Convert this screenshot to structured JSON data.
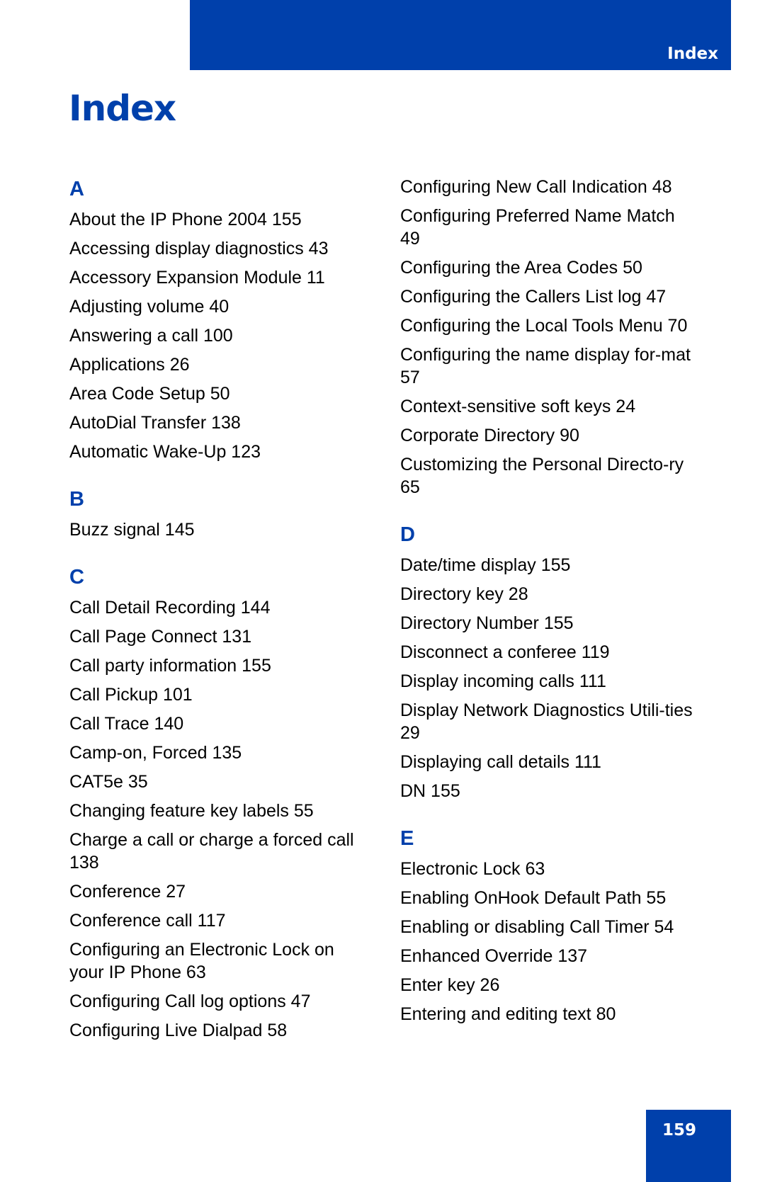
{
  "header": {
    "running_title": "Index",
    "accent_color": "#0040ab"
  },
  "page": {
    "title": "Index",
    "page_number": "159"
  },
  "columns": [
    {
      "sections": [
        {
          "letter": "A",
          "entries": [
            "About the IP Phone 2004 155",
            "Accessing display diagnostics 43",
            "Accessory Expansion Module 11",
            "Adjusting volume 40",
            "Answering a call 100",
            "Applications 26",
            "Area Code Setup 50",
            "AutoDial Transfer 138",
            "Automatic Wake-Up 123"
          ]
        },
        {
          "letter": "B",
          "entries": [
            "Buzz signal 145"
          ]
        },
        {
          "letter": "C",
          "entries": [
            "Call Detail Recording 144",
            "Call Page Connect 131",
            "Call party information 155",
            "Call Pickup 101",
            "Call Trace 140",
            "Camp-on, Forced 135",
            "CAT5e 35",
            "Changing feature key labels 55",
            "Charge a call or charge a forced call 138",
            "Conference 27",
            "Conference call 117",
            "Configuring an Electronic Lock on your IP Phone 63",
            "Configuring Call log options 47",
            "Configuring Live Dialpad 58"
          ]
        }
      ]
    },
    {
      "sections": [
        {
          "letter": "",
          "entries": [
            "Configuring New Call Indication 48",
            "Configuring Preferred Name Match 49",
            "Configuring the Area Codes 50",
            "Configuring the Callers List log 47",
            "Configuring the Local Tools Menu 70",
            "Configuring the name display for-mat 57",
            "Context-sensitive soft keys 24",
            "Corporate Directory 90",
            "Customizing the Personal Directo-ry 65"
          ]
        },
        {
          "letter": "D",
          "entries": [
            "Date/time display 155",
            "Directory key 28",
            "Directory Number 155",
            "Disconnect a conferee 119",
            "Display incoming calls 111",
            "Display Network Diagnostics Utili-ties 29",
            "Displaying call details 111",
            "DN 155"
          ]
        },
        {
          "letter": "E",
          "entries": [
            "Electronic Lock 63",
            "Enabling OnHook Default Path 55",
            "Enabling or disabling Call Timer 54",
            "Enhanced Override 137",
            "Enter key 26",
            "Entering and editing text 80"
          ]
        }
      ]
    }
  ]
}
